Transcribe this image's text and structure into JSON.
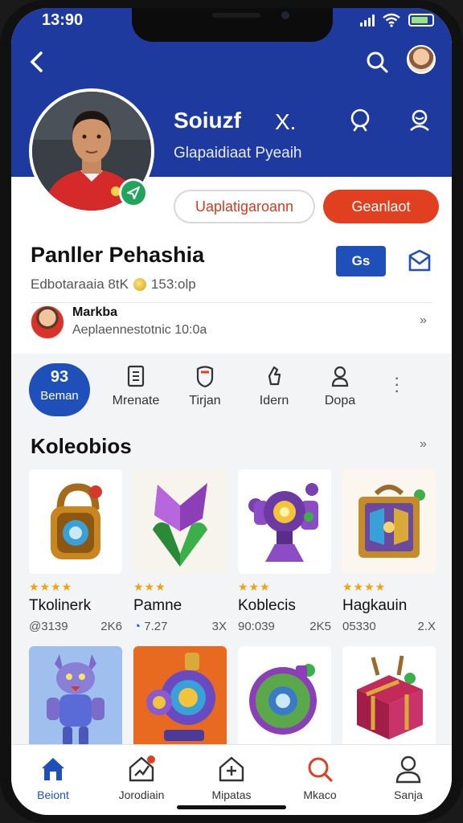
{
  "status": {
    "time": "13:90"
  },
  "header": {
    "name": "Soiuzf",
    "x_label": "X.",
    "subtitle": "Glapaidiaat Pyeaih"
  },
  "actions": {
    "outline_button": "Uaplatigaroann",
    "solid_button": "Geanlaot"
  },
  "player": {
    "name": "Panller Pehashia",
    "stats_prefix": "Edbotaraaia 8tK",
    "stats_suffix": "153:olp",
    "chip_label": "Gs"
  },
  "friend": {
    "name": "Markba",
    "subtitle": "Aeplaennestotnic 10:0a"
  },
  "tabs": [
    {
      "icon_text": "93",
      "label": "Beman"
    },
    {
      "label": "Mrenate"
    },
    {
      "label": "Tirjan"
    },
    {
      "label": "Idern"
    },
    {
      "label": "Dopa"
    }
  ],
  "section": {
    "title": "Koleobios"
  },
  "cards": [
    {
      "stars": "★★★★",
      "name": "Tkolinerk",
      "meta_left": "@3139",
      "meta_right": "2K6"
    },
    {
      "stars": "★★★",
      "name": "Pamne",
      "meta_left": "7.27",
      "meta_right": "3X"
    },
    {
      "stars": "★★★",
      "name": "Koblecis",
      "meta_left": "90:039",
      "meta_right": "2K5"
    },
    {
      "stars": "★★★★",
      "name": "Hagkauin",
      "meta_left": "05330",
      "meta_right": "2.X"
    }
  ],
  "bottom_nav": [
    {
      "label": "Beiont"
    },
    {
      "label": "Jorodiain"
    },
    {
      "label": "Mipatas"
    },
    {
      "label": "Mkaco"
    },
    {
      "label": "Sanja"
    }
  ],
  "colors": {
    "header_blue": "#1e3a9e",
    "accent_blue": "#1f4fb8",
    "accent_red": "#e0401f",
    "star_gold": "#f2a20d"
  }
}
